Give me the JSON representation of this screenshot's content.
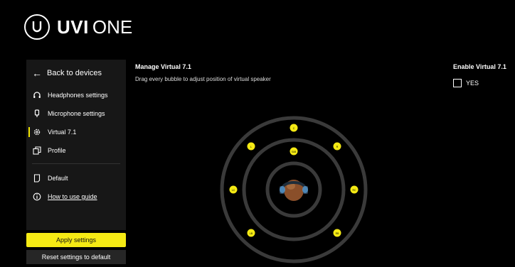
{
  "brand": {
    "name_bold": "UVI",
    "name_light": "ONE"
  },
  "sidebar": {
    "back_label": "Back to devices",
    "items": [
      {
        "label": "Headphones settings",
        "icon": "headphones-icon"
      },
      {
        "label": "Microphone settings",
        "icon": "microphone-icon"
      },
      {
        "label": "Virtual 7.1",
        "icon": "gear-icon",
        "active": true
      },
      {
        "label": "Profile",
        "icon": "profile-copy-icon"
      }
    ],
    "lower_items": [
      {
        "label": "Default",
        "icon": "document-icon"
      },
      {
        "label": "How to use guide",
        "icon": "info-icon"
      }
    ]
  },
  "buttons": {
    "apply": "Apply settings",
    "reset": "Reset settings to default"
  },
  "main": {
    "title": "Manage Virtual 7.1",
    "subtitle": "Drag every bubble to adjust position of virtual speaker"
  },
  "enable": {
    "title": "Enable Virtual 7.1",
    "option_label": "YES",
    "checked": false
  },
  "speakers": [
    {
      "label": "C"
    },
    {
      "label": "L"
    },
    {
      "label": "R"
    },
    {
      "label": "SUB"
    },
    {
      "label": "LC"
    },
    {
      "label": "RC"
    },
    {
      "label": "LB"
    },
    {
      "label": "RB"
    }
  ],
  "colors": {
    "accent": "#f5ea14",
    "ring": "#3a3a3a",
    "sidebar_bg": "#171717"
  }
}
